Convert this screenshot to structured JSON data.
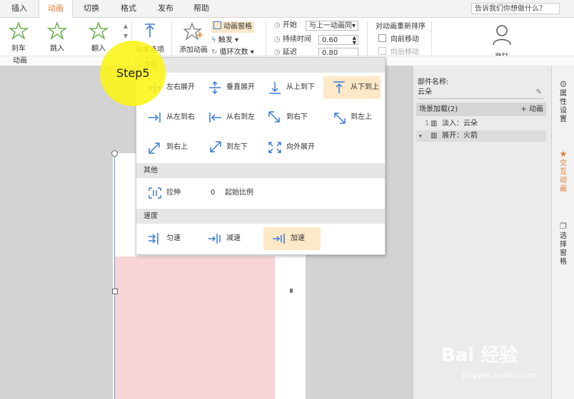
{
  "tabs": [
    "插入",
    "动画",
    "切换",
    "格式",
    "发布",
    "帮助"
  ],
  "active_tab": "动画",
  "search_placeholder": "告诉我们你想做什么？",
  "ribbon": {
    "effects": [
      "刹车",
      "跳入",
      "翻入"
    ],
    "effect_options_label": "效果选项",
    "add_animation_label": "添加动画",
    "animation_pane_label": "动画窗格",
    "trigger_label": "触发",
    "loop_label": "循环次数",
    "start_label": "开始",
    "start_value": "与上一动画同",
    "duration_label": "持续时间",
    "duration_value": "0.60",
    "delay_label": "延迟",
    "delay_value": "0.80",
    "reorder_label": "对动画重新排序",
    "move_forward": "向前移动",
    "move_backward": "向后移动",
    "login_label": "登陆",
    "group_label": "动画"
  },
  "step_label": "Step5",
  "dropdown": {
    "direction_header": "方向",
    "directions": [
      {
        "label": "左右展开",
        "icon": "split-horizontal-icon"
      },
      {
        "label": "垂直展开",
        "icon": "split-vertical-icon"
      },
      {
        "label": "从上到下",
        "icon": "arrow-down-icon"
      },
      {
        "label": "从下到上",
        "icon": "arrow-up-icon",
        "selected": true
      },
      {
        "label": "从左到右",
        "icon": "arrow-right-icon"
      },
      {
        "label": "从右到左",
        "icon": "arrow-left-icon"
      },
      {
        "label": "到右下",
        "icon": "arrow-down-right-icon"
      },
      {
        "label": "到左上",
        "icon": "arrow-up-left-icon"
      },
      {
        "label": "到右上",
        "icon": "arrow-up-right-icon"
      },
      {
        "label": "到左下",
        "icon": "arrow-down-left-icon"
      },
      {
        "label": "向外展开",
        "icon": "expand-outward-icon"
      }
    ],
    "other_header": "其他",
    "stretch_label": "拉伸",
    "start_ratio_value": "0",
    "start_ratio_label": "起始比例",
    "speed_header": "速度",
    "speeds": [
      {
        "label": "匀速",
        "icon": "uniform-speed-icon"
      },
      {
        "label": "减速",
        "icon": "decelerate-icon"
      },
      {
        "label": "加速",
        "icon": "accelerate-icon",
        "selected": true
      }
    ]
  },
  "right_panel": {
    "component_name_label": "部件名称:",
    "component_name_value": "云朵",
    "scene_load_label": "场景加载(2)",
    "add_animation_link": "+ 动画",
    "items": [
      {
        "index": "1",
        "text": "淡入：云朵"
      },
      {
        "index": "",
        "text": "展开：火箭"
      }
    ]
  },
  "side_tabs": [
    "属性设置",
    "交互动画",
    "选择窗格"
  ],
  "watermark": "Bai 经验",
  "watermark_url": "jingyan.baidu.com",
  "colors": {
    "accent": "#e57a2e",
    "selected_bg": "#fde8c8",
    "icon_blue": "#3a7bd5",
    "highlight_yellow": "#f7f214"
  }
}
